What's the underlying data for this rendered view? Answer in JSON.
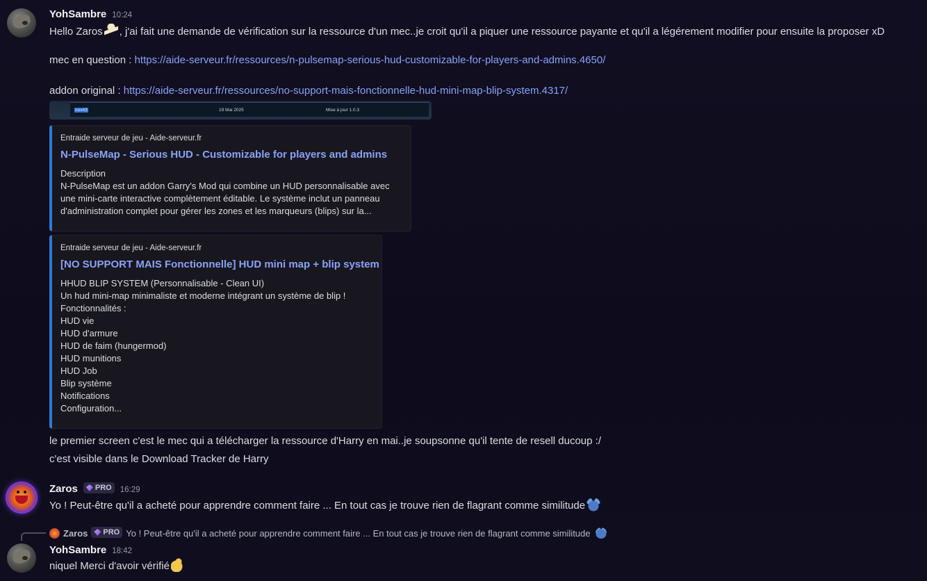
{
  "messages": [
    {
      "username": "YohSambre",
      "timestamp": "10:24",
      "lines": {
        "greeting": "Hello Zaros",
        "greeting_rest": ", j'ai fait une demande de vérification sur la ressource d'un mec..je croit qu'il a piquer une ressource payante et qu'il a légérement modifier pour ensuite la proposer xD",
        "mec_label": "mec en question : ",
        "mec_link": "https://aide-serveur.fr/ressources/n-pulsemap-serious-hud-customizable-for-players-and-admins.4650/",
        "addon_label": "addon original : ",
        "addon_link": "https://aide-serveur.fr/ressources/no-support-mais-fonctionnelle-hud-mini-map-blip-system.4317/"
      },
      "attachment": {
        "user": "nos43",
        "date": "19 Mai 2025",
        "update": "Mise à jour 1.0.3"
      },
      "embeds": [
        {
          "provider": "Entraide serveur de jeu - Aide-serveur.fr",
          "title": "N-PulseMap - Serious HUD - Customizable for players and admins",
          "description": [
            "Description",
            "N-PulseMap est un addon Garry's Mod qui combine un HUD personnalisable avec",
            "une mini-carte interactive complètement éditable. Le système inclut un panneau",
            "d'administration complet pour gérer les zones et les marqueurs (blips) sur la..."
          ]
        },
        {
          "provider": "Entraide serveur de jeu - Aide-serveur.fr",
          "title": "[NO SUPPORT MAIS Fonctionnelle] HUD mini map + blip system",
          "description": [
            "HHUD BLIP SYSTEM (Personnalisable - Clean UI)",
            "Un hud mini-map minimaliste et moderne intégrant un système de blip !",
            "Fonctionnalités :",
            "HUD vie",
            "HUD d'armure",
            "HUD de faim (hungermod)",
            "HUD munitions",
            "HUD Job",
            "Blip système",
            "Notifications",
            "Configuration..."
          ]
        }
      ],
      "followups": [
        "le premier screen c'est le mec qui a télécharger la ressource d'Harry en mai..je soupsonne qu'il tente de resell ducoup :/",
        "c'est visible dans le Download Tracker de Harry"
      ]
    },
    {
      "username": "Zaros",
      "badge": "PRO",
      "timestamp": "16:29",
      "text": "Yo ! Peut-être qu'il a acheté pour apprendre comment faire ... En tout cas je trouve rien de flagrant comme similitude"
    },
    {
      "reply": {
        "username": "Zaros",
        "badge": "PRO",
        "text": "Yo ! Peut-être qu'il a acheté pour apprendre comment faire ... En tout cas je trouve rien de flagrant comme similitude"
      },
      "username": "YohSambre",
      "timestamp": "18:42",
      "text": "niquel Merci d'avoir vérifié"
    }
  ],
  "icons": {
    "dancer": "dancing-emoji-icon",
    "stitch": "stitch-emoji-icon",
    "thumbs_up": "thumbs-up-emoji-icon",
    "pro_gem": "pro-gem-icon"
  },
  "colors": {
    "link": "#8aa2f8",
    "embed_border": "#2e7bd1",
    "background": "#0f0d1d"
  }
}
